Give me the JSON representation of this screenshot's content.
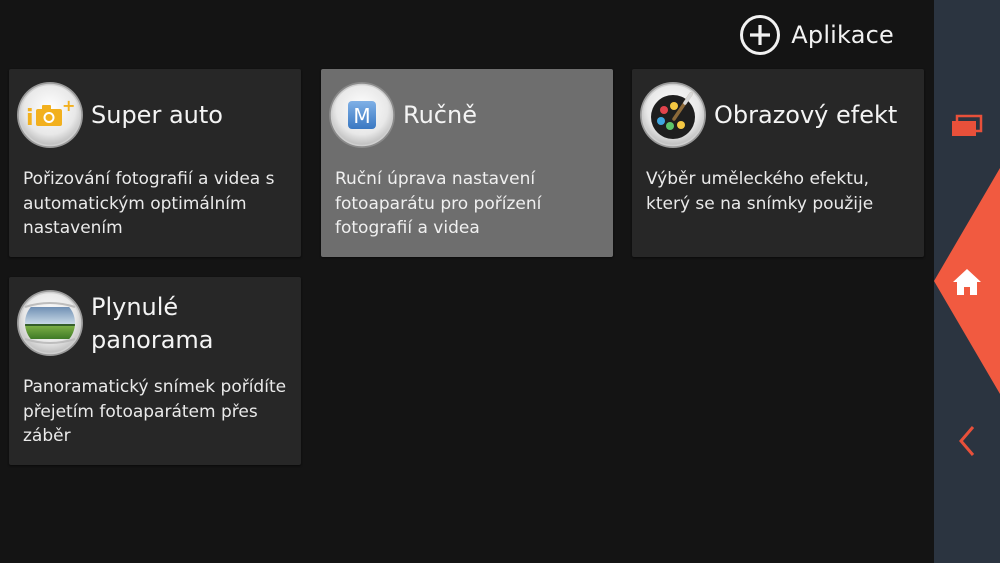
{
  "header": {
    "apps_label": "Aplikace"
  },
  "modes": [
    {
      "title": "Super auto",
      "description": "Pořizování fotografií a videa s automatickým optimálním nastavením",
      "icon": "camera-auto-icon"
    },
    {
      "title": "Ručně",
      "description": "Ruční úprava nastavení fotoaparátu pro pořízení fotografií a videa",
      "icon": "manual-mode-icon",
      "selected": true
    },
    {
      "title": "Obrazový efekt",
      "description": "Výběr uměleckého efektu, který se na snímky použije",
      "icon": "palette-icon"
    },
    {
      "title": "Plynulé panorama",
      "description": "Panoramatický snímek pořídíte přejetím fotoaparátem přes záběr",
      "icon": "panorama-icon"
    }
  ],
  "navbar": {
    "items": [
      "recent-apps-icon",
      "home-icon",
      "back-icon"
    ],
    "accent_color": "#f15a40",
    "background_color": "#2b3440"
  },
  "colors": {
    "background": "#141414",
    "card": "#272727",
    "card_selected": "#6e6e6e"
  }
}
